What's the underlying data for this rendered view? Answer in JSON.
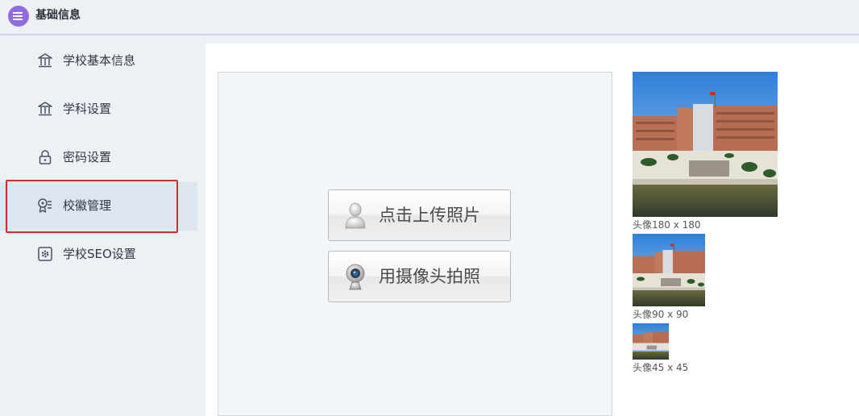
{
  "header": {
    "title": "基础信息",
    "icon": "list-icon",
    "icon_color": "#8f6ddf"
  },
  "sidebar": {
    "items": [
      {
        "label": "学校基本信息",
        "icon": "building-icon"
      },
      {
        "label": "学科设置",
        "icon": "building-icon"
      },
      {
        "label": "密码设置",
        "icon": "lock-icon"
      },
      {
        "label": "校徽管理",
        "icon": "badge-icon",
        "active": true
      },
      {
        "label": "学校SEO设置",
        "icon": "gear-square-icon"
      }
    ],
    "highlight_color": "#e02525"
  },
  "upload": {
    "upload_button_label": "点击上传照片",
    "camera_button_label": "用摄像头拍照"
  },
  "previews": {
    "large_label": "头像180 x 180",
    "medium_label": "头像90 x 90",
    "small_label": "头像45 x 45"
  }
}
